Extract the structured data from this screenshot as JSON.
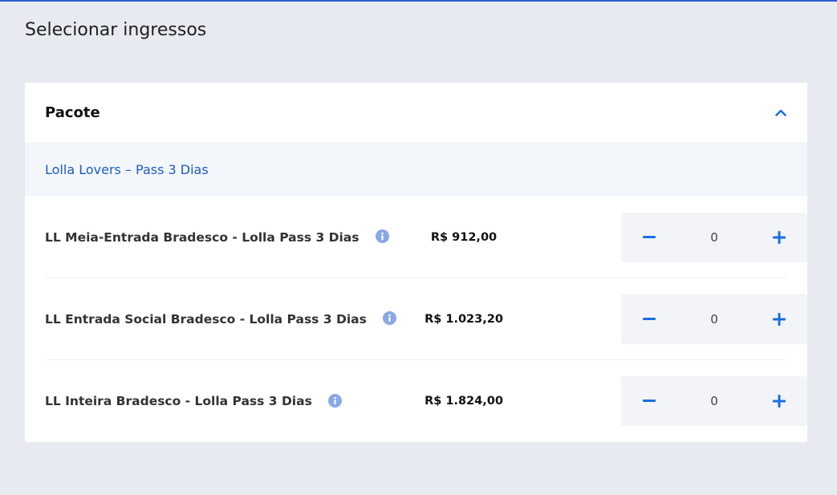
{
  "page": {
    "title": "Selecionar ingressos"
  },
  "panel": {
    "title": "Pacote",
    "expanded": true,
    "group_label": "Lolla Lovers – Pass 3 Dias"
  },
  "tickets": [
    {
      "name": "LL Meia-Entrada Bradesco - Lolla Pass 3 Dias",
      "price": "R$ 912,00",
      "quantity": "0"
    },
    {
      "name": "LL Entrada Social Bradesco - Lolla Pass 3 Dias",
      "price": "R$ 1.023,20",
      "quantity": "0"
    },
    {
      "name": "LL Inteira Bradesco - Lolla Pass 3 Dias",
      "price": "R$ 1.824,00",
      "quantity": "0"
    }
  ],
  "icons": {
    "collapse": "chevron-up-icon",
    "info": "info-icon",
    "decrement": "minus-icon",
    "increment": "plus-icon"
  },
  "colors": {
    "accent": "#1a6fe0",
    "link": "#1d5bc3",
    "info": "#8aa7e6",
    "background": "#e8eaf1"
  }
}
